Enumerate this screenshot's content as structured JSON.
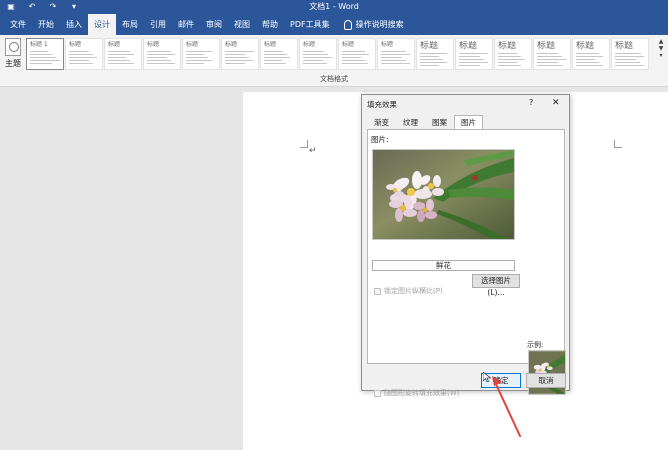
{
  "titlebar": {
    "title": "文档1 - Word",
    "qat": {
      "save": "▣",
      "undo": "↶",
      "redo": "↷",
      "customize": "▾"
    }
  },
  "ribbon": {
    "tabs": [
      {
        "label": "文件"
      },
      {
        "label": "开始"
      },
      {
        "label": "插入"
      },
      {
        "label": "设计",
        "active": true
      },
      {
        "label": "布局"
      },
      {
        "label": "引用"
      },
      {
        "label": "邮件"
      },
      {
        "label": "审阅"
      },
      {
        "label": "视图"
      },
      {
        "label": "帮助"
      },
      {
        "label": "PDF工具集"
      }
    ],
    "tell_me": "操作说明搜索",
    "theme_label": "主题",
    "group_label": "文档格式",
    "style_gallery": [
      {
        "heading": "标题 1"
      },
      {
        "heading": "标题"
      },
      {
        "heading": "标题"
      },
      {
        "heading": "标题"
      },
      {
        "heading": "标题"
      },
      {
        "heading": "标题"
      },
      {
        "heading": "标题"
      },
      {
        "heading": "标题"
      },
      {
        "heading": "标题"
      },
      {
        "heading": "标题"
      },
      {
        "heading": "标题"
      },
      {
        "heading": "标题"
      },
      {
        "heading": "标题"
      },
      {
        "heading": "标题"
      },
      {
        "heading": "标题"
      },
      {
        "heading": "标题"
      }
    ]
  },
  "dialog": {
    "title": "填充效果",
    "help": "?",
    "close": "✕",
    "tabs": [
      {
        "label": "渐变"
      },
      {
        "label": "纹理"
      },
      {
        "label": "图案"
      },
      {
        "label": "图片",
        "active": true
      }
    ],
    "picture_label": "图片:",
    "picture_name": "鲜花",
    "select_button": "选择图片(L)...",
    "lock_aspect": "锁定图片纵横比(P)",
    "rotate_with_shape": "随图形旋转填充效果(W)",
    "sample_label": "示例:",
    "ok": "确定",
    "cancel": "取消"
  },
  "colors": {
    "word_blue": "#2b579a",
    "ok_border": "#0078d7",
    "arrow": "#e0453a"
  }
}
